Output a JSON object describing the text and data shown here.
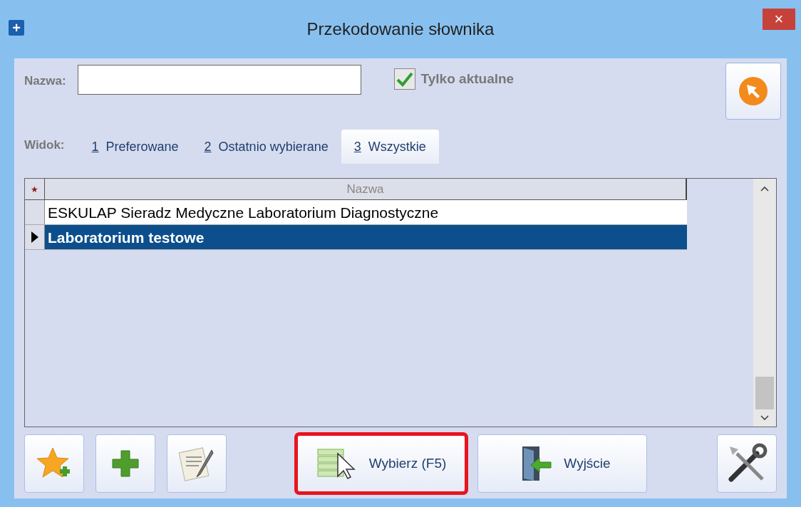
{
  "window": {
    "title": "Przekodowanie słownika",
    "close_glyph": "×",
    "plus_glyph": "+"
  },
  "filter": {
    "label": "Nazwa:",
    "checkbox": {
      "label": "Tylko aktualne",
      "checked": true
    }
  },
  "view": {
    "label": "Widok:",
    "tabs": [
      {
        "key": "1",
        "label": "Preferowane",
        "selected": false
      },
      {
        "key": "2",
        "label": "Ostatnio wybierane",
        "selected": false
      },
      {
        "key": "3",
        "label": "Wszystkie",
        "selected": true
      }
    ]
  },
  "table": {
    "star_glyph": "★",
    "columns": [
      "Nazwa"
    ],
    "rows": [
      {
        "cells": [
          "ESKULAP Sieradz Medyczne Laboratorium Diagnostyczne"
        ],
        "selected": false
      },
      {
        "cells": [
          "Laboratorium testowe"
        ],
        "selected": true
      }
    ]
  },
  "buttons": [
    {
      "kind": "icon"
    },
    {
      "kind": "icon"
    },
    {
      "kind": "icon"
    },
    {
      "kind": "text",
      "label": "Wybierz (F5)",
      "highlighted": true
    },
    {
      "kind": "text",
      "label": "Wyjście",
      "highlighted": false
    },
    {
      "kind": "icon"
    }
  ]
}
